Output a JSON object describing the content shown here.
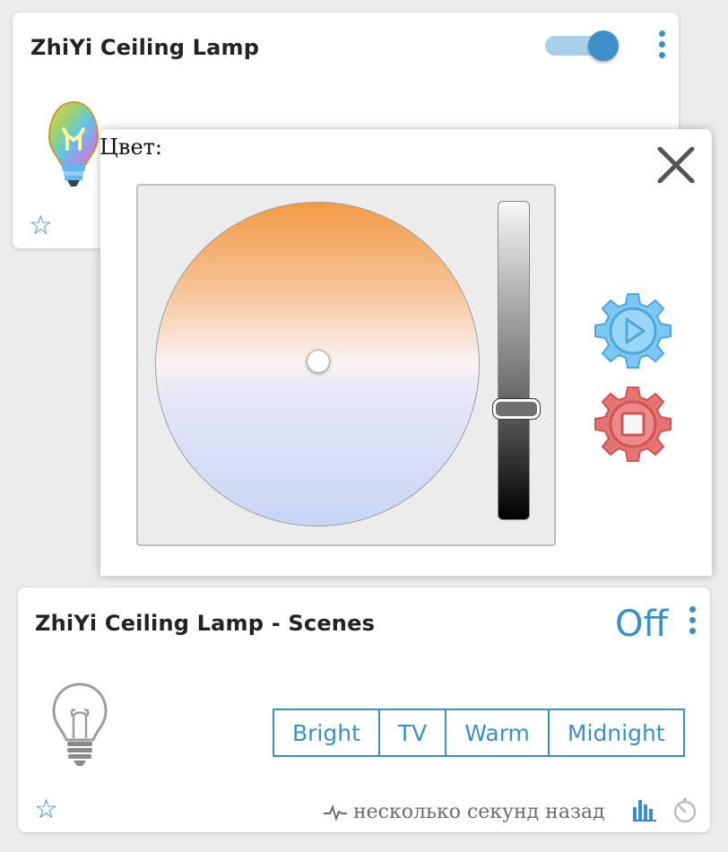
{
  "device_card": {
    "title": "ZhiYi Ceiling Lamp",
    "power": "on",
    "icon": "color-bulb-icon"
  },
  "color_dialog": {
    "label": "Цвет:",
    "brightness_level": 0.38,
    "color_point": "center",
    "actions": [
      "play-gear-icon",
      "stop-gear-icon"
    ]
  },
  "scenes_card": {
    "title": "ZhiYi Ceiling Lamp - Scenes",
    "status": "Off",
    "scenes": [
      "Bright",
      "TV",
      "Warm",
      "Midnight"
    ],
    "last_update": "несколько секунд назад",
    "icon": "light-bulb-icon"
  },
  "colors": {
    "accent": "#3b8fc9",
    "play_gear": "#7cc7f4",
    "stop_gear": "#e57373"
  }
}
